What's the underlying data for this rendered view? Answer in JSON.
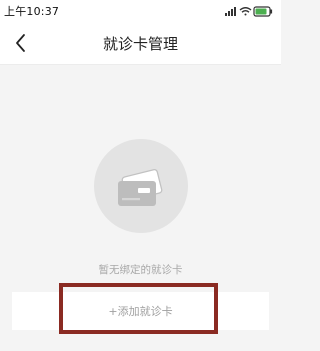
{
  "status_bar": {
    "time": "上午10:37",
    "battery_level": 0.85
  },
  "header": {
    "title": "就诊卡管理",
    "back_icon": "chevron-left-icon"
  },
  "empty_state": {
    "illustration_icon": "card-icon",
    "message": "暂无绑定的就诊卡"
  },
  "actions": {
    "add_card_label": "+添加就诊卡"
  },
  "colors": {
    "background": "#f4f4f4",
    "illustration_bg": "#e3e3e3",
    "highlight": "#8a2a22",
    "battery": "#4caf50"
  }
}
